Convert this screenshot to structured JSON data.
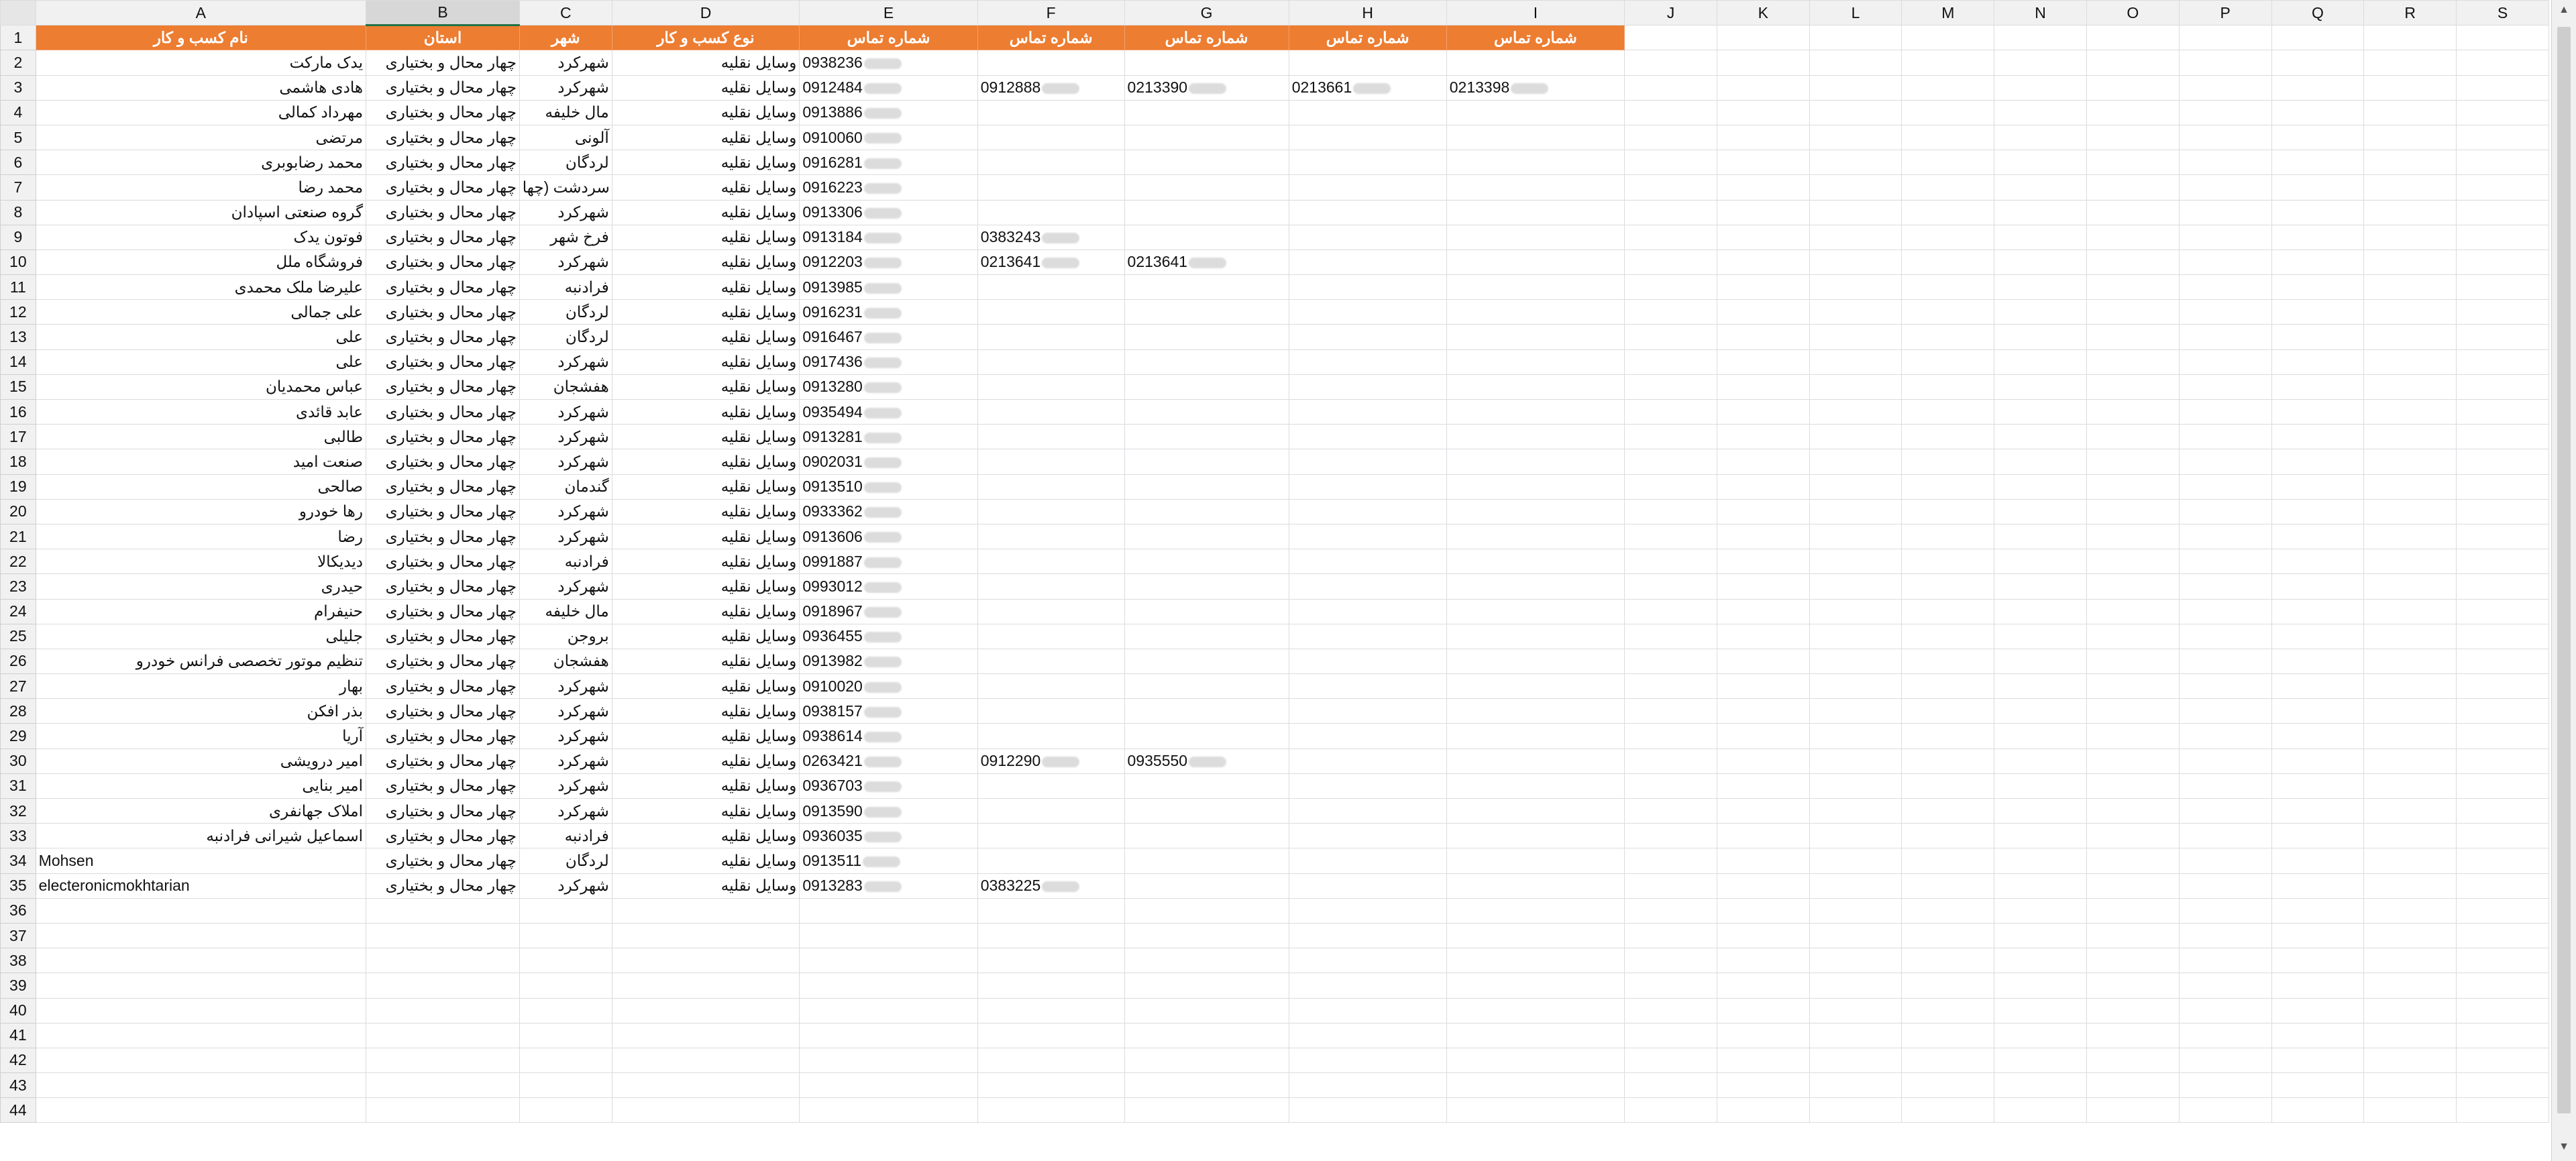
{
  "columns": [
    "A",
    "B",
    "C",
    "D",
    "E",
    "F",
    "G",
    "H",
    "I",
    "J",
    "K",
    "L",
    "M",
    "N",
    "O",
    "P",
    "Q",
    "R",
    "S"
  ],
  "selected_column": "B",
  "header_row": {
    "A": "نام کسب و کار",
    "B": "استان",
    "C": "شهر",
    "D": "نوع کسب و کار",
    "E": "شماره تماس",
    "F": "شماره تماس",
    "G": "شماره تماس",
    "H": "شماره تماس",
    "I": "شماره تماس"
  },
  "header_color": "#ed7d31",
  "rows": [
    {
      "A": "یدک مارکت",
      "B": "چهار محال و بختیاری",
      "C": "شهرکرد",
      "D": "وسایل نقلیه",
      "E": "0938236",
      "F": "",
      "G": "",
      "H": "",
      "I": ""
    },
    {
      "A": "هادی هاشمی",
      "B": "چهار محال و بختیاری",
      "C": "شهرکرد",
      "D": "وسایل نقلیه",
      "E": "0912484",
      "F": "0912888",
      "G": "0213390",
      "H": "0213661",
      "I": "0213398"
    },
    {
      "A": "مهرداد کمالی",
      "B": "چهار محال و بختیاری",
      "C": "مال خلیفه",
      "D": "وسایل نقلیه",
      "E": "0913886",
      "F": "",
      "G": "",
      "H": "",
      "I": ""
    },
    {
      "A": "مرتضی",
      "B": "چهار محال و بختیاری",
      "C": "آلونی",
      "D": "وسایل نقلیه",
      "E": "0910060",
      "F": "",
      "G": "",
      "H": "",
      "I": ""
    },
    {
      "A": "محمد رضابوبری",
      "B": "چهار محال و بختیاری",
      "C": "لردگان",
      "D": "وسایل نقلیه",
      "E": "0916281",
      "F": "",
      "G": "",
      "H": "",
      "I": ""
    },
    {
      "A": "محمد رضا",
      "B": "چهار محال و بختیاری",
      "C": "سردشت (چها",
      "D": "وسایل نقلیه",
      "E": "0916223",
      "F": "",
      "G": "",
      "H": "",
      "I": ""
    },
    {
      "A": "گروه صنعتی اسپادان",
      "B": "چهار محال و بختیاری",
      "C": "شهرکرد",
      "D": "وسایل نقلیه",
      "E": "0913306",
      "F": "",
      "G": "",
      "H": "",
      "I": ""
    },
    {
      "A": "فوتون یدک",
      "B": "چهار محال و بختیاری",
      "C": "فرخ شهر",
      "D": "وسایل نقلیه",
      "E": "0913184",
      "F": "0383243",
      "G": "",
      "H": "",
      "I": ""
    },
    {
      "A": "فروشگاه ملل",
      "B": "چهار محال و بختیاری",
      "C": "شهرکرد",
      "D": "وسایل نقلیه",
      "E": "0912203",
      "F": "0213641",
      "G": "0213641",
      "H": "",
      "I": ""
    },
    {
      "A": "علیرضا ملک محمدی",
      "B": "چهار محال و بختیاری",
      "C": "فرادنبه",
      "D": "وسایل نقلیه",
      "E": "0913985",
      "F": "",
      "G": "",
      "H": "",
      "I": ""
    },
    {
      "A": "علی جمالی",
      "B": "چهار محال و بختیاری",
      "C": "لردگان",
      "D": "وسایل نقلیه",
      "E": "0916231",
      "F": "",
      "G": "",
      "H": "",
      "I": ""
    },
    {
      "A": "علی",
      "B": "چهار محال و بختیاری",
      "C": "لردگان",
      "D": "وسایل نقلیه",
      "E": "0916467",
      "F": "",
      "G": "",
      "H": "",
      "I": ""
    },
    {
      "A": "علی",
      "B": "چهار محال و بختیاری",
      "C": "شهرکرد",
      "D": "وسایل نقلیه",
      "E": "0917436",
      "F": "",
      "G": "",
      "H": "",
      "I": ""
    },
    {
      "A": "عباس محمدیان",
      "B": "چهار محال و بختیاری",
      "C": "هفشجان",
      "D": "وسایل نقلیه",
      "E": "0913280",
      "F": "",
      "G": "",
      "H": "",
      "I": ""
    },
    {
      "A": "عابد قائدی",
      "B": "چهار محال و بختیاری",
      "C": "شهرکرد",
      "D": "وسایل نقلیه",
      "E": "0935494",
      "F": "",
      "G": "",
      "H": "",
      "I": ""
    },
    {
      "A": "طالبی",
      "B": "چهار محال و بختیاری",
      "C": "شهرکرد",
      "D": "وسایل نقلیه",
      "E": "0913281",
      "F": "",
      "G": "",
      "H": "",
      "I": ""
    },
    {
      "A": "صنعت امید",
      "B": "چهار محال و بختیاری",
      "C": "شهرکرد",
      "D": "وسایل نقلیه",
      "E": "0902031",
      "F": "",
      "G": "",
      "H": "",
      "I": ""
    },
    {
      "A": "صالحی",
      "B": "چهار محال و بختیاری",
      "C": "گندمان",
      "D": "وسایل نقلیه",
      "E": "0913510",
      "F": "",
      "G": "",
      "H": "",
      "I": ""
    },
    {
      "A": "رها خودرو",
      "B": "چهار محال و بختیاری",
      "C": "شهرکرد",
      "D": "وسایل نقلیه",
      "E": "0933362",
      "F": "",
      "G": "",
      "H": "",
      "I": ""
    },
    {
      "A": "رضا",
      "B": "چهار محال و بختیاری",
      "C": "شهرکرد",
      "D": "وسایل نقلیه",
      "E": "0913606",
      "F": "",
      "G": "",
      "H": "",
      "I": ""
    },
    {
      "A": "دیدیکالا",
      "B": "چهار محال و بختیاری",
      "C": "فرادنبه",
      "D": "وسایل نقلیه",
      "E": "0991887",
      "F": "",
      "G": "",
      "H": "",
      "I": ""
    },
    {
      "A": "حیدری",
      "B": "چهار محال و بختیاری",
      "C": "شهرکرد",
      "D": "وسایل نقلیه",
      "E": "0993012",
      "F": "",
      "G": "",
      "H": "",
      "I": ""
    },
    {
      "A": "حنیفرام",
      "B": "چهار محال و بختیاری",
      "C": "مال خلیفه",
      "D": "وسایل نقلیه",
      "E": "0918967",
      "F": "",
      "G": "",
      "H": "",
      "I": ""
    },
    {
      "A": "جلیلی",
      "B": "چهار محال و بختیاری",
      "C": "بروجن",
      "D": "وسایل نقلیه",
      "E": "0936455",
      "F": "",
      "G": "",
      "H": "",
      "I": ""
    },
    {
      "A": "تنظیم موتور تخصصی فرانس خودرو",
      "B": "چهار محال و بختیاری",
      "C": "هفشجان",
      "D": "وسایل نقلیه",
      "E": "0913982",
      "F": "",
      "G": "",
      "H": "",
      "I": ""
    },
    {
      "A": "بهار",
      "B": "چهار محال و بختیاری",
      "C": "شهرکرد",
      "D": "وسایل نقلیه",
      "E": "0910020",
      "F": "",
      "G": "",
      "H": "",
      "I": ""
    },
    {
      "A": "بذر افکن",
      "B": "چهار محال و بختیاری",
      "C": "شهرکرد",
      "D": "وسایل نقلیه",
      "E": "0938157",
      "F": "",
      "G": "",
      "H": "",
      "I": ""
    },
    {
      "A": "آریا",
      "B": "چهار محال و بختیاری",
      "C": "شهرکرد",
      "D": "وسایل نقلیه",
      "E": "0938614",
      "F": "",
      "G": "",
      "H": "",
      "I": ""
    },
    {
      "A": "امیر درویشی",
      "B": "چهار محال و بختیاری",
      "C": "شهرکرد",
      "D": "وسایل نقلیه",
      "E": "0263421",
      "F": "0912290",
      "G": "0935550",
      "H": "",
      "I": ""
    },
    {
      "A": "امیر بنایی",
      "B": "چهار محال و بختیاری",
      "C": "شهرکرد",
      "D": "وسایل نقلیه",
      "E": "0936703",
      "F": "",
      "G": "",
      "H": "",
      "I": ""
    },
    {
      "A": "املاک جهانفری",
      "B": "چهار محال و بختیاری",
      "C": "شهرکرد",
      "D": "وسایل نقلیه",
      "E": "0913590",
      "F": "",
      "G": "",
      "H": "",
      "I": ""
    },
    {
      "A": "اسماعیل شیرانی فرادنبه",
      "B": "چهار محال و بختیاری",
      "C": "فرادنبه",
      "D": "وسایل نقلیه",
      "E": "0936035",
      "F": "",
      "G": "",
      "H": "",
      "I": ""
    },
    {
      "A": "Mohsen",
      "B": "چهار محال و بختیاری",
      "C": "لردگان",
      "D": "وسایل نقلیه",
      "E": "0913511",
      "F": "",
      "G": "",
      "H": "",
      "I": ""
    },
    {
      "A": "electeronicmokhtarian",
      "B": "چهار محال و بختیاری",
      "C": "شهرکرد",
      "D": "وسایل نقلیه",
      "E": "0913283",
      "F": "0383225",
      "G": "",
      "H": "",
      "I": ""
    }
  ],
  "empty_row_numbers": [
    36,
    37,
    38,
    39,
    40,
    41,
    42,
    43,
    44
  ],
  "scrollbar": {
    "up_arrow": "▲",
    "down_arrow": "▼"
  }
}
